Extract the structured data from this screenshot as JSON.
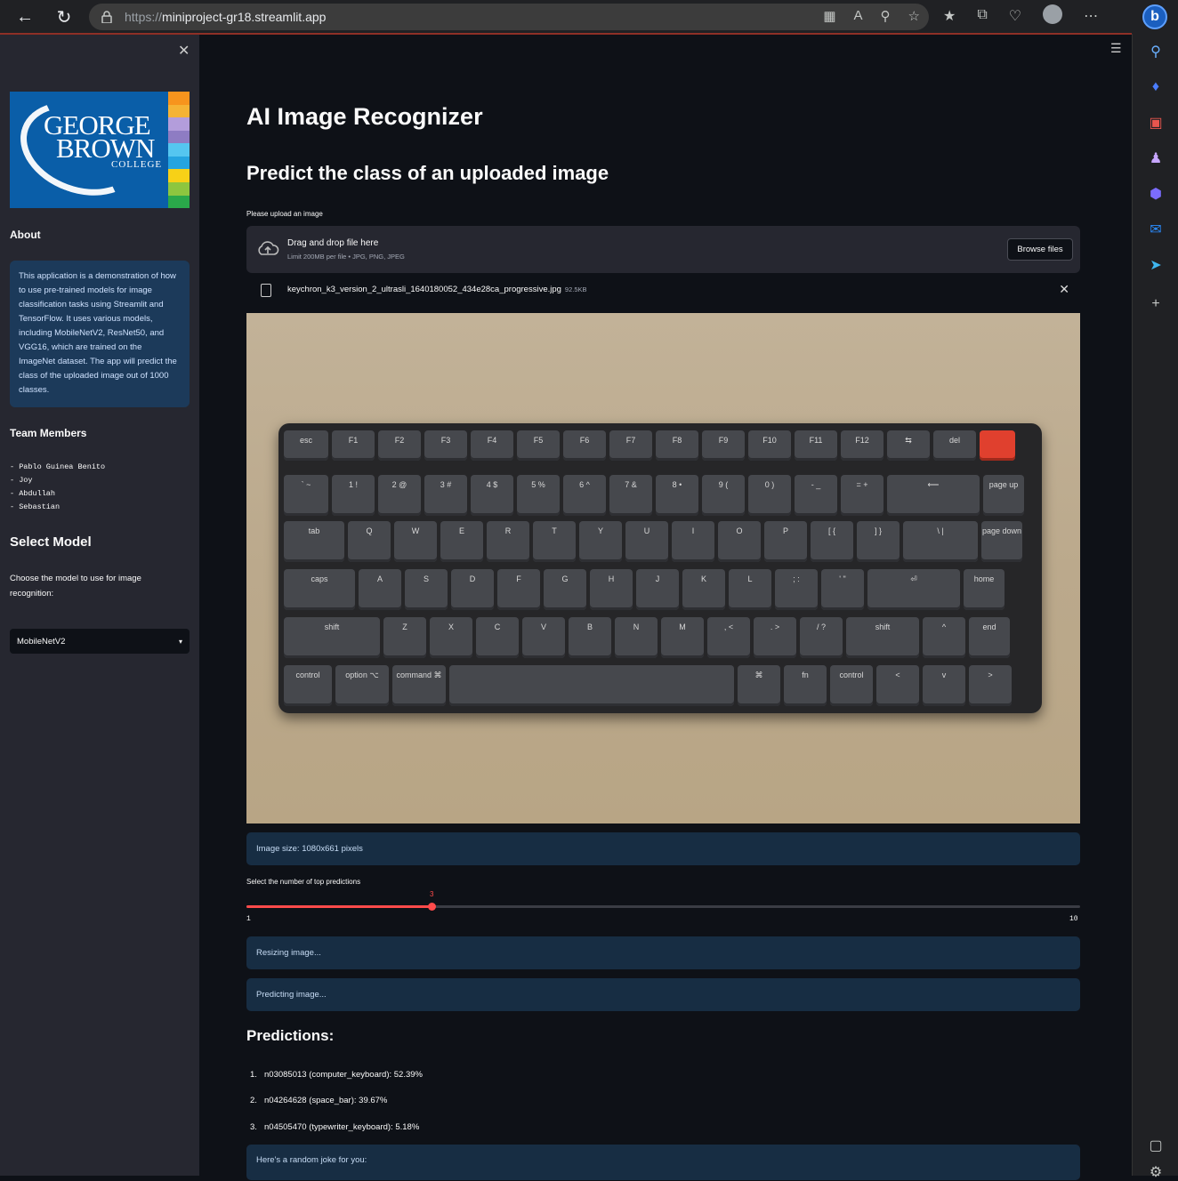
{
  "browser": {
    "url_protocol": "https://",
    "url_host": "miniproject-gr18.streamlit.app",
    "bing_label": "b"
  },
  "sidebar": {
    "close_icon": "close-icon",
    "logo": {
      "line1": "GEORGE",
      "line2": "BROWN",
      "line3": "COLLEGE",
      "stripe_colors": [
        "#f7941d",
        "#f5b335",
        "#b39ddb",
        "#8e7cc3",
        "#55c6f0",
        "#25a4e0",
        "#f7d117",
        "#8dc63f",
        "#2aa84a"
      ]
    },
    "about_heading": "About",
    "about_text": "This application is a demonstration of how to use pre-trained models for image classification tasks using Streamlit and TensorFlow. It uses various models, including MobileNetV2, ResNet50, and VGG16, which are trained on the ImageNet dataset. The app will predict the class of the uploaded image out of 1000 classes.",
    "team_heading": "Team Members",
    "team_members": [
      "- Pablo Guinea Benito",
      "- Joy",
      "- Abdullah",
      "- Sebastian"
    ],
    "select_heading": "Select Model",
    "select_prompt": "Choose the model to use for image recognition:",
    "selected_model": "MobileNetV2"
  },
  "main": {
    "title": "AI Image Recognizer",
    "subtitle": "Predict the class of an uploaded image",
    "upload_label": "Please upload an image",
    "dropzone_text": "Drag and drop file here",
    "dropzone_limit": "Limit 200MB per file • JPG, PNG, JPEG",
    "browse_label": "Browse files",
    "file_name": "keychron_k3_version_2_ultrasli_1640180052_434e28ca_progressive.jpg",
    "file_size": "92.5KB",
    "image_size_text": "Image size: 1080x661 pixels",
    "slider_label": "Select the number of top predictions",
    "slider": {
      "min": 1,
      "max": 10,
      "value": 3,
      "min_label": "1",
      "max_label": "10",
      "value_label": "3"
    },
    "status_resizing": "Resizing image...",
    "status_predicting": "Predicting image...",
    "predictions_heading": "Predictions:",
    "predictions": [
      {
        "num": "1.",
        "text": "n03085013 (computer_keyboard): 52.39%"
      },
      {
        "num": "2.",
        "text": "n04264628 (space_bar): 39.67%"
      },
      {
        "num": "3.",
        "text": "n04505470 (typewriter_keyboard): 5.18%"
      }
    ],
    "joke_text": "Here's a random joke for you:",
    "accent_color": "#ff4b4b"
  },
  "keyboard": {
    "rows": [
      [
        "esc",
        "F1",
        "F2",
        "F3",
        "F4",
        "F5",
        "F6",
        "F7",
        "F8",
        "F9",
        "F10",
        "F11",
        "F12",
        "⇆",
        "del",
        "●"
      ],
      [
        "` ~",
        "1 !",
        "2 @",
        "3 #",
        "4 $",
        "5 %",
        "6 ^",
        "7 &",
        "8 •",
        "9 (",
        "0 )",
        "- _",
        "= +",
        "⟵",
        "page up"
      ],
      [
        "tab",
        "Q",
        "W",
        "E",
        "R",
        "T",
        "Y",
        "U",
        "I",
        "O",
        "P",
        "[ {",
        "] }",
        "\\ |",
        "page down"
      ],
      [
        "caps",
        "A",
        "S",
        "D",
        "F",
        "G",
        "H",
        "J",
        "K",
        "L",
        "; :",
        "' \"",
        "⏎",
        "home"
      ],
      [
        "shift",
        "Z",
        "X",
        "C",
        "V",
        "B",
        "N",
        "M",
        ", <",
        ". >",
        "/ ?",
        "shift",
        "^",
        "end"
      ],
      [
        "control",
        "option ⌥",
        "command ⌘",
        "",
        "⌘",
        "fn",
        "control",
        "<",
        "v",
        ">"
      ]
    ]
  }
}
